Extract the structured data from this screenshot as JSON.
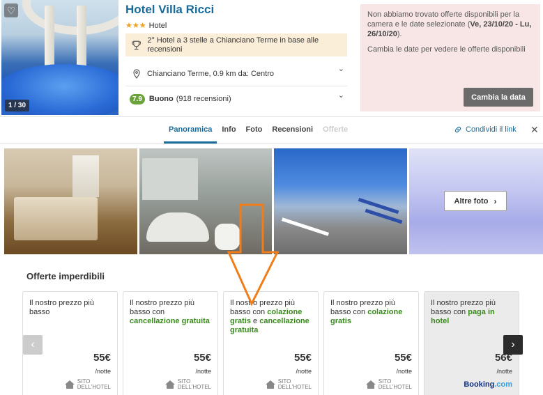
{
  "hotel": {
    "name": "Hotel Villa Ricci",
    "stars": "★★★",
    "type": "Hotel",
    "award": "2° Hotel a 3 stelle a Chianciano Terme in base alle recensioni",
    "location": "Chianciano Terme, 0.9 km da: Centro",
    "score": "7.9",
    "rating_label": "Buono",
    "reviews": "(918 recensioni)"
  },
  "hero": {
    "counter": "1 / 30"
  },
  "notice": {
    "text_before": "Non abbiamo trovato offerte disponibili per la camera e le date selezionate (",
    "dates": "Ve, 23/10/20 - Lu, 26/10/20",
    "text_after": ").",
    "hint": "Cambia le date per vedere le offerte disponibili",
    "button": "Cambia la data"
  },
  "tabs": [
    {
      "label": "Panoramica",
      "state": "active"
    },
    {
      "label": "Info",
      "state": "normal"
    },
    {
      "label": "Foto",
      "state": "normal"
    },
    {
      "label": "Recensioni",
      "state": "normal"
    },
    {
      "label": "Offerte",
      "state": "disabled"
    }
  ],
  "share_label": "Condividi il link",
  "close_glyph": "✕",
  "gallery": {
    "more_label": "Altre foto"
  },
  "offers": {
    "title": "Offerte imperdibili",
    "cards": [
      {
        "line1": "Il nostro prezzo più basso",
        "highlight": "",
        "price": "55€",
        "per": "/notte",
        "source_top": "SITO",
        "source_bottom": "DELL'HOTEL"
      },
      {
        "line1": "Il nostro prezzo più basso con",
        "highlight": "cancellazione gratuita",
        "price": "55€",
        "per": "/notte",
        "source_top": "SITO",
        "source_bottom": "DELL'HOTEL"
      },
      {
        "line1": "Il nostro prezzo più basso con",
        "highlight": "colazione gratis",
        "mid": "e",
        "highlight2": "cancellazione gratuita",
        "price": "55€",
        "per": "/notte",
        "source_top": "SITO",
        "source_bottom": "DELL'HOTEL"
      },
      {
        "line1": "Il nostro prezzo più basso con",
        "highlight": "colazione gratis",
        "price": "55€",
        "per": "/notte",
        "source_top": "SITO",
        "source_bottom": "DELL'HOTEL"
      },
      {
        "line1": "Il nostro prezzo più basso con",
        "highlight": "paga in hotel",
        "price": "56€",
        "per": "/notte",
        "booking_a": "Booking",
        "booking_b": ".com"
      }
    ]
  },
  "colors": {
    "accent": "#1a6b9a",
    "green": "#3a8a1e",
    "arrow": "#f07d1a",
    "score_bg": "#6aa33c"
  }
}
